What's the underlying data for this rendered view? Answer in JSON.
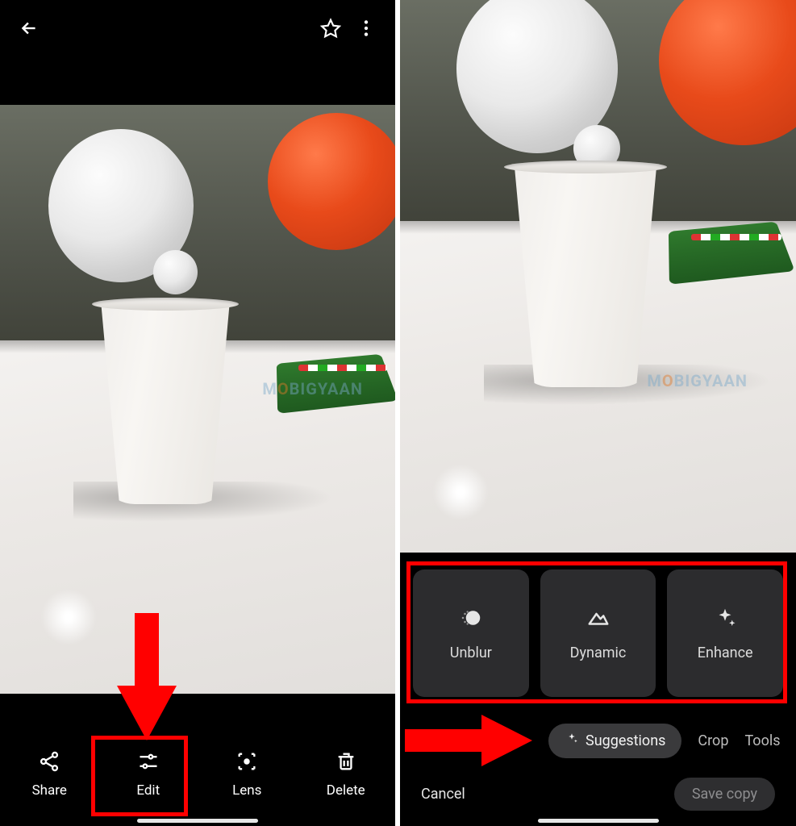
{
  "watermark": {
    "pre": "M",
    "mid": "O",
    "post": "BIGYAAN"
  },
  "left": {
    "actions": {
      "share": "Share",
      "edit": "Edit",
      "lens": "Lens",
      "delete": "Delete"
    }
  },
  "right": {
    "tiles": {
      "unblur": "Unblur",
      "dynamic": "Dynamic",
      "enhance": "Enhance"
    },
    "tabs": {
      "suggestions": "Suggestions",
      "crop": "Crop",
      "tools": "Tools"
    },
    "buttons": {
      "cancel": "Cancel",
      "save": "Save copy"
    }
  }
}
